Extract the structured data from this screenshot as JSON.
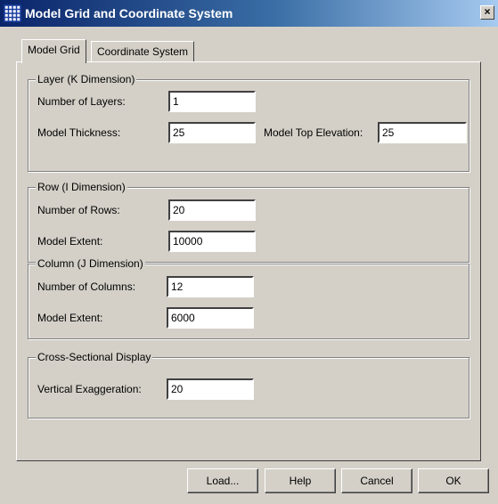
{
  "window": {
    "title": "Model Grid and Coordinate System",
    "close_glyph": "×"
  },
  "tabs": [
    {
      "label": "Model Grid",
      "active": true
    },
    {
      "label": "Coordinate System",
      "active": false
    }
  ],
  "layer_group": {
    "title": "Layer (K Dimension)",
    "num_layers_label": "Number of Layers:",
    "num_layers_value": "1",
    "thickness_label": "Model Thickness:",
    "thickness_value": "25",
    "top_elev_label": "Model Top Elevation:",
    "top_elev_value": "25"
  },
  "row_group": {
    "title": "Row (I Dimension)",
    "num_rows_label": "Number of Rows:",
    "num_rows_value": "20",
    "extent_label": "Model Extent:",
    "extent_value": "10000"
  },
  "column_group": {
    "title": "Column (J Dimension)",
    "num_cols_label": "Number of Columns:",
    "num_cols_value": "12",
    "extent_label": "Model Extent:",
    "extent_value": "6000"
  },
  "cross_section_group": {
    "title": "Cross-Sectional Display",
    "vert_exag_label": "Vertical Exaggeration:",
    "vert_exag_value": "20"
  },
  "buttons": {
    "load": "Load...",
    "help": "Help",
    "cancel": "Cancel",
    "ok": "OK"
  },
  "colors": {
    "titlebar_start": "#0a246a",
    "titlebar_end": "#a6caf0",
    "face": "#d4d0c8"
  },
  "icons": {
    "app": "grid-icon",
    "close": "close-icon"
  }
}
